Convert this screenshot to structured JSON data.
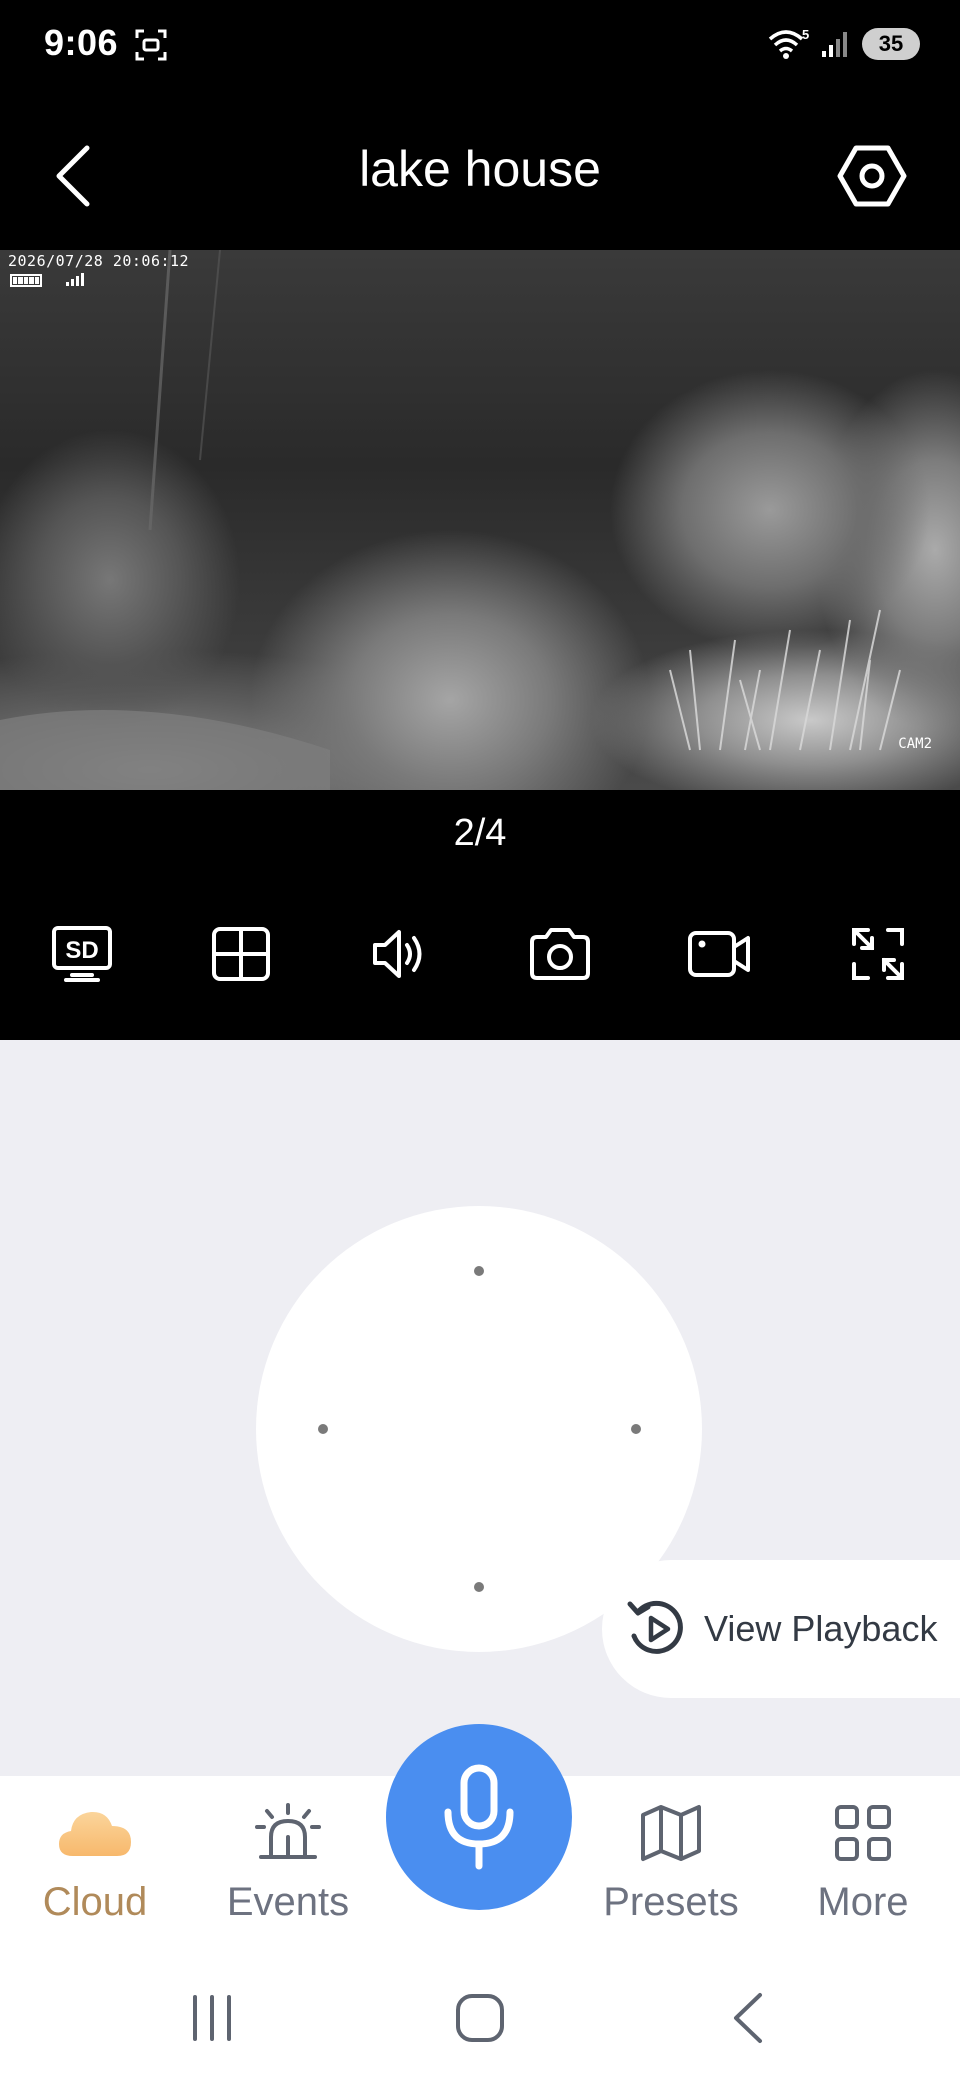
{
  "status_bar": {
    "time": "9:06",
    "wifi_badge": "5",
    "battery": "35"
  },
  "header": {
    "title": "lake house",
    "back_icon": "chevron-left-icon",
    "settings_icon": "hexagon-settings-icon"
  },
  "video": {
    "timestamp": "2026/07/28 20:06:12",
    "camera_label": "CAM2"
  },
  "page_indicator": "2/4",
  "toolbar": {
    "items": [
      {
        "name": "sd-quality-button",
        "icon": "sd-monitor-icon",
        "label": "SD"
      },
      {
        "name": "split-view-button",
        "icon": "grid-icon"
      },
      {
        "name": "audio-button",
        "icon": "speaker-icon"
      },
      {
        "name": "snapshot-button",
        "icon": "camera-icon"
      },
      {
        "name": "record-button",
        "icon": "video-camera-icon"
      },
      {
        "name": "fullscreen-button",
        "icon": "expand-icon"
      }
    ]
  },
  "playback": {
    "label": "View Playback",
    "icon": "replay-icon"
  },
  "bottom_nav": {
    "cloud": "Cloud",
    "events": "Events",
    "presets": "Presets",
    "more": "More",
    "active": "Cloud"
  },
  "colors": {
    "accent_blue": "#4a8ef0",
    "active_tab": "#b08a5a",
    "panel_bg": "#eeeef3"
  }
}
